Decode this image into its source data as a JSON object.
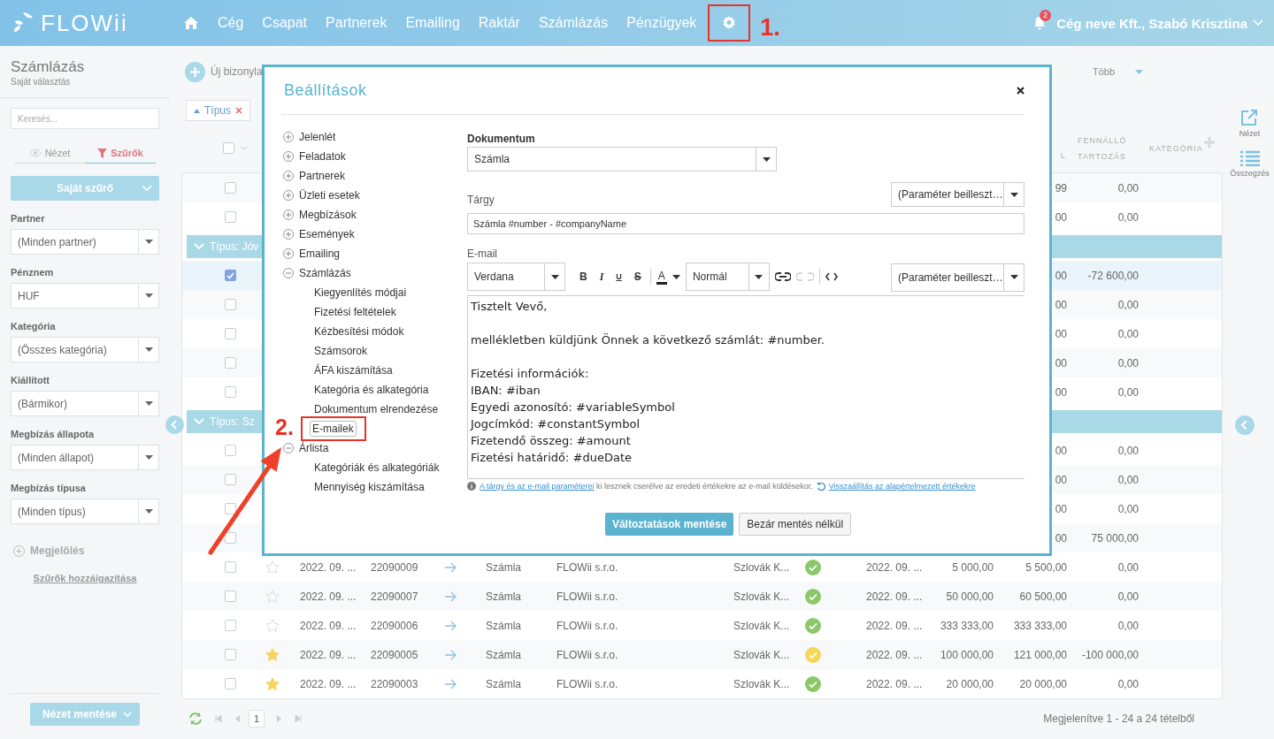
{
  "header": {
    "logo": "FLOWii",
    "nav": [
      {
        "label": "Cég"
      },
      {
        "label": "Csapat"
      },
      {
        "label": "Partnerek"
      },
      {
        "label": "Emailing"
      },
      {
        "label": "Raktár"
      },
      {
        "label": "Számlázás"
      },
      {
        "label": "Pénzügyek"
      }
    ],
    "notification_count": "2",
    "user": "Cég neve Kft., Szabó Krisztina"
  },
  "annotations": [
    {
      "label": "1."
    },
    {
      "label": "2."
    }
  ],
  "sidebar": {
    "title": "Számlázás",
    "subtitle": "Saját választás",
    "search": {
      "placeholder": "Keresés..."
    },
    "tabs": [
      {
        "label": "Nézet",
        "selected": false
      },
      {
        "label": "Szűrők",
        "selected": true
      }
    ],
    "filter_button": "Saját szűrő",
    "filters": [
      {
        "label": "Partner",
        "value": "(Minden partner)"
      },
      {
        "label": "Pénznem",
        "value": "HUF"
      },
      {
        "label": "Kategória",
        "value": "(Összes kategória)"
      },
      {
        "label": "Kiállított",
        "value": "(Bármikor)"
      },
      {
        "label": "Megbízás állapota",
        "value": "(Minden állapot)"
      },
      {
        "label": "Megbízás típusa",
        "value": "(Minden típus)"
      }
    ],
    "marking": "Megjelölés",
    "assign_link": "Szűrők hozzáigazítása",
    "save_view": "Nézet mentése"
  },
  "toolbar": {
    "new_document": "Új bizonyla",
    "more": "Több",
    "chip": "Típus"
  },
  "table": {
    "select_all": {
      "checked": false
    },
    "columns": [
      "L",
      "FENNÁLLÓ TARTOZÁS",
      "KATEGÓRIA"
    ],
    "rows": [
      {
        "kind": "row",
        "checked": false,
        "gross": "99",
        "outstanding": "0,00"
      },
      {
        "kind": "row",
        "checked": false,
        "gross": "00",
        "outstanding": "0,00"
      },
      {
        "kind": "group",
        "label": "Típus: Jóv"
      },
      {
        "kind": "row",
        "checked": true,
        "gross": "00",
        "outstanding": "-72 600,00"
      },
      {
        "kind": "row",
        "checked": false,
        "gross": "00",
        "outstanding": "0,00"
      },
      {
        "kind": "row",
        "checked": false,
        "gross": "00",
        "outstanding": "0,00"
      },
      {
        "kind": "row",
        "checked": false,
        "gross": "00",
        "outstanding": "0,00"
      },
      {
        "kind": "row",
        "checked": false,
        "gross": "00",
        "outstanding": "0,00"
      },
      {
        "kind": "group",
        "label": "Típus: Sz"
      },
      {
        "kind": "row",
        "checked": false,
        "gross": "00",
        "outstanding": "0,00"
      },
      {
        "kind": "row",
        "checked": false,
        "gross": "00",
        "outstanding": "0,00"
      },
      {
        "kind": "row",
        "checked": false,
        "gross": "00",
        "outstanding": "0,00"
      },
      {
        "kind": "row",
        "checked": false,
        "gross": "00",
        "outstanding": "75 000,00"
      },
      {
        "kind": "row",
        "checked": false,
        "starred": false,
        "date": "2022. 09. ...",
        "number": "22090009",
        "type": "Számla",
        "partner": "FLOWii s.r.o.",
        "customer": "Szlovák K...",
        "color": "#8bc86a",
        "date2": "2022. 09. ...",
        "net": "5 000,00",
        "gross": "5 500,00",
        "outstanding": "0,00"
      },
      {
        "kind": "row",
        "checked": false,
        "starred": false,
        "date": "2022. 09. ...",
        "number": "22090007",
        "type": "Számla",
        "partner": "FLOWii s.r.o.",
        "customer": "Szlovák K...",
        "color": "#8bc86a",
        "date2": "2022. 09. ...",
        "net": "50 000,00",
        "gross": "60 500,00",
        "outstanding": "0,00"
      },
      {
        "kind": "row",
        "checked": false,
        "starred": false,
        "date": "2022. 09. ...",
        "number": "22090006",
        "type": "Számla",
        "partner": "FLOWii s.r.o.",
        "customer": "Szlovák K...",
        "color": "#8bc86a",
        "date2": "2022. 09. ...",
        "net": "333 333,00",
        "gross": "333 333,00",
        "outstanding": "0,00"
      },
      {
        "kind": "row",
        "checked": false,
        "starred": true,
        "date": "2022. 09. ...",
        "number": "22090005",
        "type": "Számla",
        "partner": "FLOWii s.r.o.",
        "customer": "Szlovák K...",
        "color": "#f5d657",
        "date2": "2022. 09. ...",
        "net": "100 000,00",
        "gross": "121 000,00",
        "outstanding": "-100 000,00"
      },
      {
        "kind": "row",
        "checked": false,
        "starred": true,
        "date": "2022. 09. ...",
        "number": "22090003",
        "type": "Számla",
        "partner": "FLOWii s.r.o.",
        "customer": "Szlovák K...",
        "color": "#8bc86a",
        "date2": "2022. 09. ...",
        "net": "20 000,00",
        "gross": "20 000,00",
        "outstanding": "0,00"
      }
    ]
  },
  "pager": {
    "page": "1",
    "summary": "Megjelenítve 1 - 24 a 24 tételből"
  },
  "right_rail": [
    {
      "label": "Nézet"
    },
    {
      "label": "Összegzés"
    }
  ],
  "dialog": {
    "title": "Beállítások",
    "tree": [
      {
        "label": "Jelenlét",
        "expanded": false
      },
      {
        "label": "Feladatok",
        "expanded": false
      },
      {
        "label": "Partnerek",
        "expanded": false
      },
      {
        "label": "Üzleti esetek",
        "expanded": false
      },
      {
        "label": "Megbízások",
        "expanded": false
      },
      {
        "label": "Események",
        "expanded": false
      },
      {
        "label": "Emailing",
        "expanded": false
      },
      {
        "label": "Számlázás",
        "expanded": true,
        "children": [
          {
            "label": "Kiegyenlítés módjai",
            "selected": false
          },
          {
            "label": "Fizetési feltételek",
            "selected": false
          },
          {
            "label": "Kézbesítési módok",
            "selected": false
          },
          {
            "label": "Számsorok",
            "selected": false
          },
          {
            "label": "ÁFA kiszámítása",
            "selected": false
          },
          {
            "label": "Kategória és alkategória",
            "selected": false
          },
          {
            "label": "Dokumentum elrendezése",
            "selected": false
          },
          {
            "label": "E-mailek",
            "selected": true
          }
        ]
      },
      {
        "label": "Árlista",
        "expanded": true,
        "children": [
          {
            "label": "Kategóriák és alkategóriák",
            "selected": false
          },
          {
            "label": "Mennyiség kiszámítása",
            "selected": false
          }
        ]
      }
    ],
    "document": {
      "label": "Dokumentum",
      "value": "Számla"
    },
    "subject": {
      "label": "Tárgy",
      "value": "Számla #number - #companyName",
      "param": "(Paraméter beilleszt…"
    },
    "email": {
      "label": "E-mail",
      "font": "Verdana",
      "format_buttons": [
        "B",
        "I",
        "U",
        "S"
      ],
      "color_button": "A",
      "size": "Normál",
      "param": "(Paraméter beilleszt…",
      "body": [
        [
          "Tisztelt Vevő,"
        ],
        [
          "mellékletben küldjünk Önnek a következő számlát: #number."
        ],
        [
          "Fizetési információk:",
          "IBAN: #iban",
          "Egyedi azonosító: #variableSymbol",
          "Jogcímkód: #constantSymbol",
          "Fizetendő összeg: #amount",
          "Fizetési határidő: #dueDate"
        ]
      ]
    },
    "hint": {
      "link": "A tárgy és az e-mail paraméterei",
      "text": " ki lesznek cserélve az eredeti értékekre az e-mail küldésekor.",
      "reset": "Visszaállítás az alapértelmezett értékekre"
    },
    "buttons": [
      {
        "label": "Változtatások mentése",
        "kind": "primary"
      },
      {
        "label": "Bezár mentés nélkül",
        "kind": "secondary"
      }
    ]
  }
}
